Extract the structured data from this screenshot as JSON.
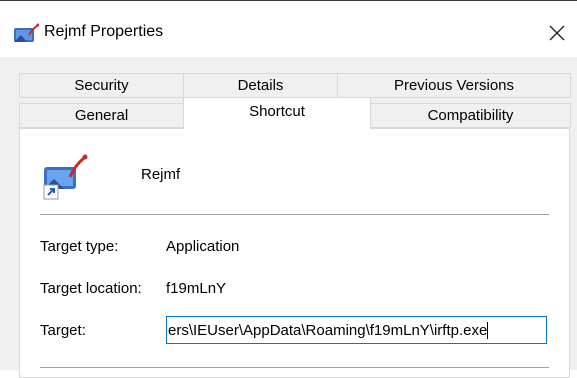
{
  "window": {
    "title": "Rejmf Properties",
    "title_icon": "shortcut-app-icon",
    "close_icon": "close-icon"
  },
  "tabs": {
    "row1": [
      "Security",
      "Details",
      "Previous Versions"
    ],
    "row2": [
      "General",
      "Shortcut",
      "Compatibility"
    ],
    "selected": "Shortcut"
  },
  "shortcut": {
    "name": "Rejmf",
    "target_type_label": "Target type:",
    "target_type_value": "Application",
    "target_location_label": "Target location:",
    "target_location_value": "f19mLnY",
    "target_label": "Target:",
    "target_value": "ers\\IEUser\\AppData\\Roaming\\f19mLnY\\irftp.exe"
  },
  "colors": {
    "accent": "#0078d7",
    "background": "#f0f0f0"
  }
}
